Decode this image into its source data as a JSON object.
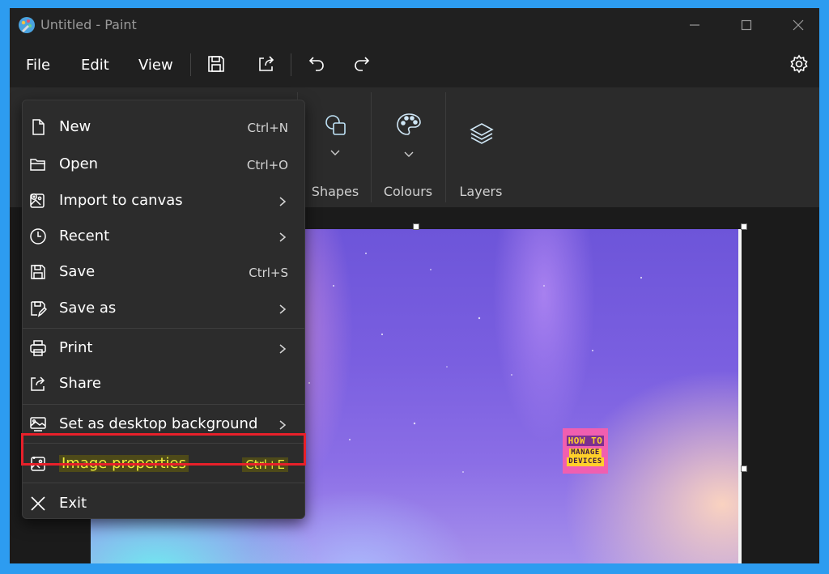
{
  "window": {
    "title": "Untitled - Paint"
  },
  "menubar": {
    "file": "File",
    "edit": "Edit",
    "view": "View"
  },
  "toolbar": {
    "icons": [
      "save-icon",
      "share-icon",
      "undo-icon",
      "redo-icon",
      "settings-icon"
    ]
  },
  "ribbon": {
    "groups": [
      {
        "label": "Shapes",
        "icon": "shapes-icon"
      },
      {
        "label": "Colours",
        "icon": "palette-icon"
      },
      {
        "label": "Layers",
        "icon": "layers-icon"
      }
    ]
  },
  "file_menu": {
    "items": [
      {
        "label": "New",
        "shortcut": "Ctrl+N",
        "icon": "new-file-icon"
      },
      {
        "label": "Open",
        "shortcut": "Ctrl+O",
        "icon": "folder-icon"
      },
      {
        "label": "Import to canvas",
        "submenu": true,
        "icon": "import-image-icon"
      },
      {
        "label": "Recent",
        "submenu": true,
        "icon": "clock-icon"
      },
      {
        "label": "Save",
        "shortcut": "Ctrl+S",
        "icon": "save-icon"
      },
      {
        "label": "Save as",
        "submenu": true,
        "icon": "save-as-icon"
      },
      {
        "label": "Print",
        "submenu": true,
        "icon": "printer-icon"
      },
      {
        "label": "Share",
        "icon": "share-icon"
      },
      {
        "label": "Set as desktop background",
        "submenu": true,
        "icon": "desktop-background-icon"
      },
      {
        "label": "Image properties",
        "shortcut": "Ctrl+E",
        "icon": "image-properties-icon",
        "highlighted": true
      },
      {
        "label": "Exit",
        "icon": "close-icon"
      }
    ]
  },
  "canvas": {
    "logo": {
      "line1": "HOW TO",
      "line2": "MANAGE",
      "line3": "DEVICES"
    }
  },
  "colors": {
    "highlight_border": "#e8202a",
    "highlight_text": "#eded3c",
    "window_bg": "#202020",
    "frame": "#2d9cf0"
  }
}
